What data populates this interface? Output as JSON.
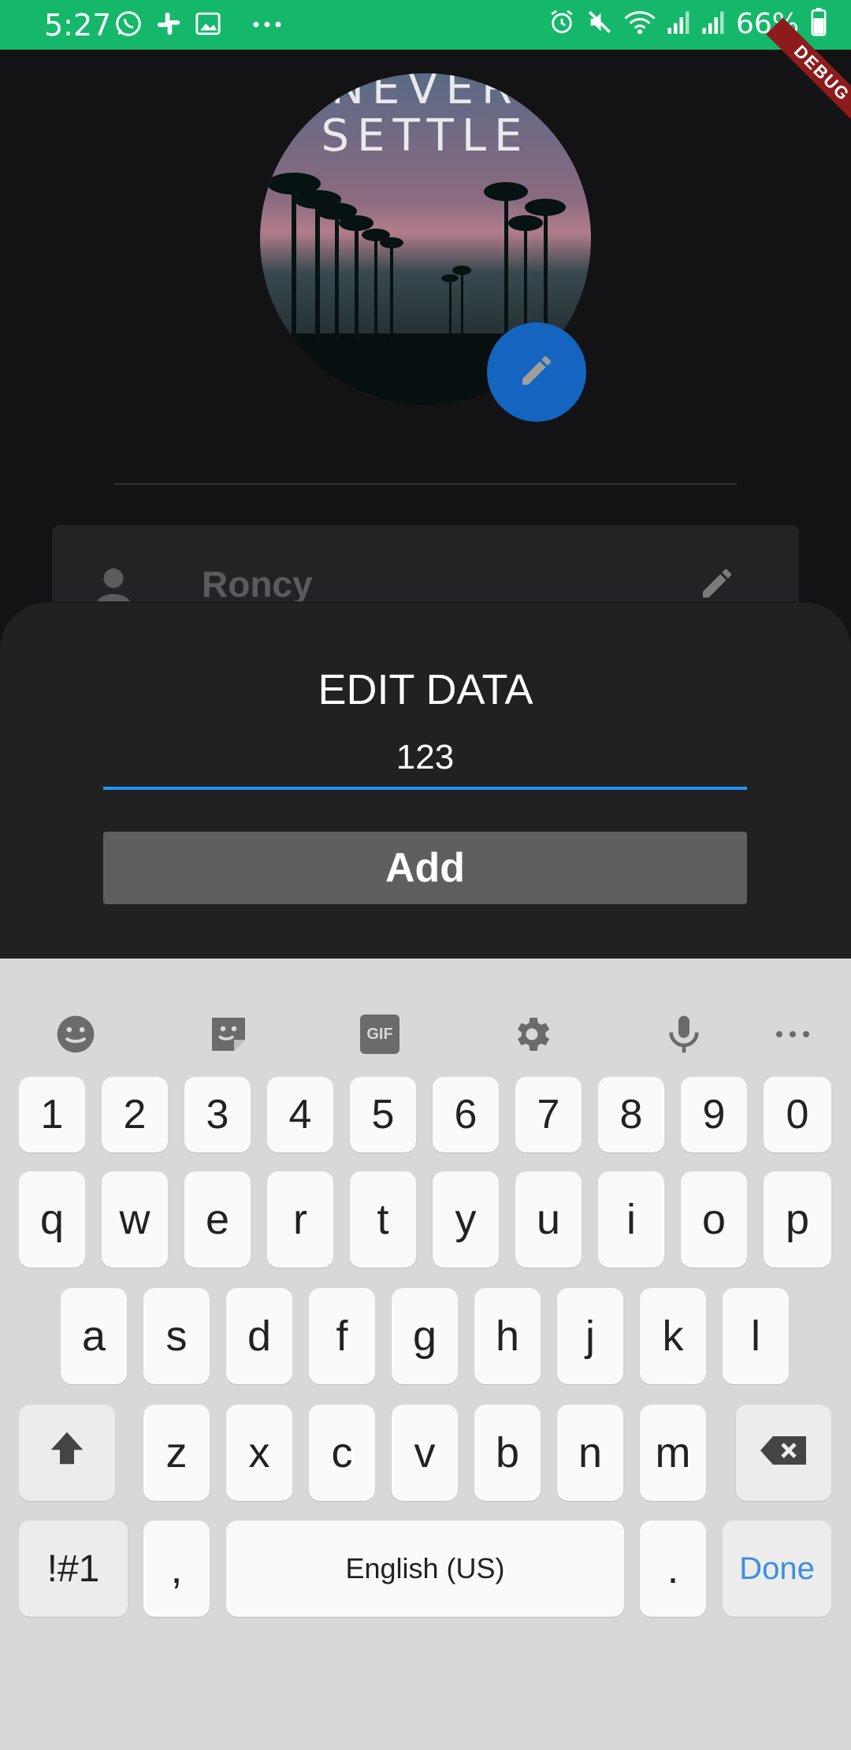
{
  "status_bar": {
    "time": "5:27",
    "battery": "66%",
    "left_icons": [
      "whatsapp-icon",
      "slack-icon",
      "gallery-icon",
      "more-dots-icon"
    ],
    "right_icons": [
      "alarm-icon",
      "mute-icon",
      "wifi-icon",
      "signal-icon",
      "signal-icon-2",
      "battery-icon"
    ],
    "color": "#15b86a"
  },
  "debug_banner": "DEBUG",
  "profile": {
    "avatar_text_line1": "NEVER",
    "avatar_text_line2": "SETTLE",
    "name": "Roncy"
  },
  "sheet": {
    "title": "EDIT DATA",
    "input_value": "123",
    "add_label": "Add"
  },
  "keyboard": {
    "toolbar_icons": [
      "emoji-icon",
      "sticker-icon",
      "gif-icon",
      "settings-icon",
      "microphone-icon",
      "more-icon"
    ],
    "gif_label": "GIF",
    "row_numbers": [
      "1",
      "2",
      "3",
      "4",
      "5",
      "6",
      "7",
      "8",
      "9",
      "0"
    ],
    "row1": [
      "q",
      "w",
      "e",
      "r",
      "t",
      "y",
      "u",
      "i",
      "o",
      "p"
    ],
    "row2": [
      "a",
      "s",
      "d",
      "f",
      "g",
      "h",
      "j",
      "k",
      "l"
    ],
    "row3": [
      "z",
      "x",
      "c",
      "v",
      "b",
      "n",
      "m"
    ],
    "symbols_label": "!#1",
    "comma_label": ",",
    "space_label": "English (US)",
    "period_label": ".",
    "done_label": "Done"
  }
}
